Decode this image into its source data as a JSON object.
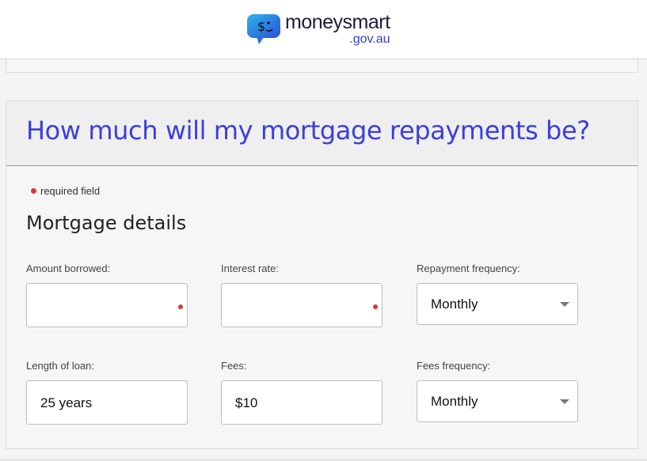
{
  "header": {
    "brand_name": "moneysmart",
    "brand_domain": ".gov.au",
    "logo_icon": "speech-bubble-smiley-icon"
  },
  "calculator": {
    "title": "How much will my mortgage repayments be?",
    "required_note": "required field",
    "section_title": "Mortgage details",
    "fields": {
      "amount_borrowed": {
        "label": "Amount borrowed:",
        "value": ""
      },
      "interest_rate": {
        "label": "Interest rate:",
        "value": ""
      },
      "repayment_frequency": {
        "label": "Repayment frequency:",
        "value": "Monthly"
      },
      "length_of_loan": {
        "label": "Length of loan:",
        "value": "25 years"
      },
      "fees": {
        "label": "Fees:",
        "value": "$10"
      },
      "fees_frequency": {
        "label": "Fees frequency:",
        "value": "Monthly"
      }
    }
  },
  "colors": {
    "title_blue": "#3c3de0",
    "required_red": "#d03b3b",
    "brand_domain_blue": "#3340c9"
  }
}
